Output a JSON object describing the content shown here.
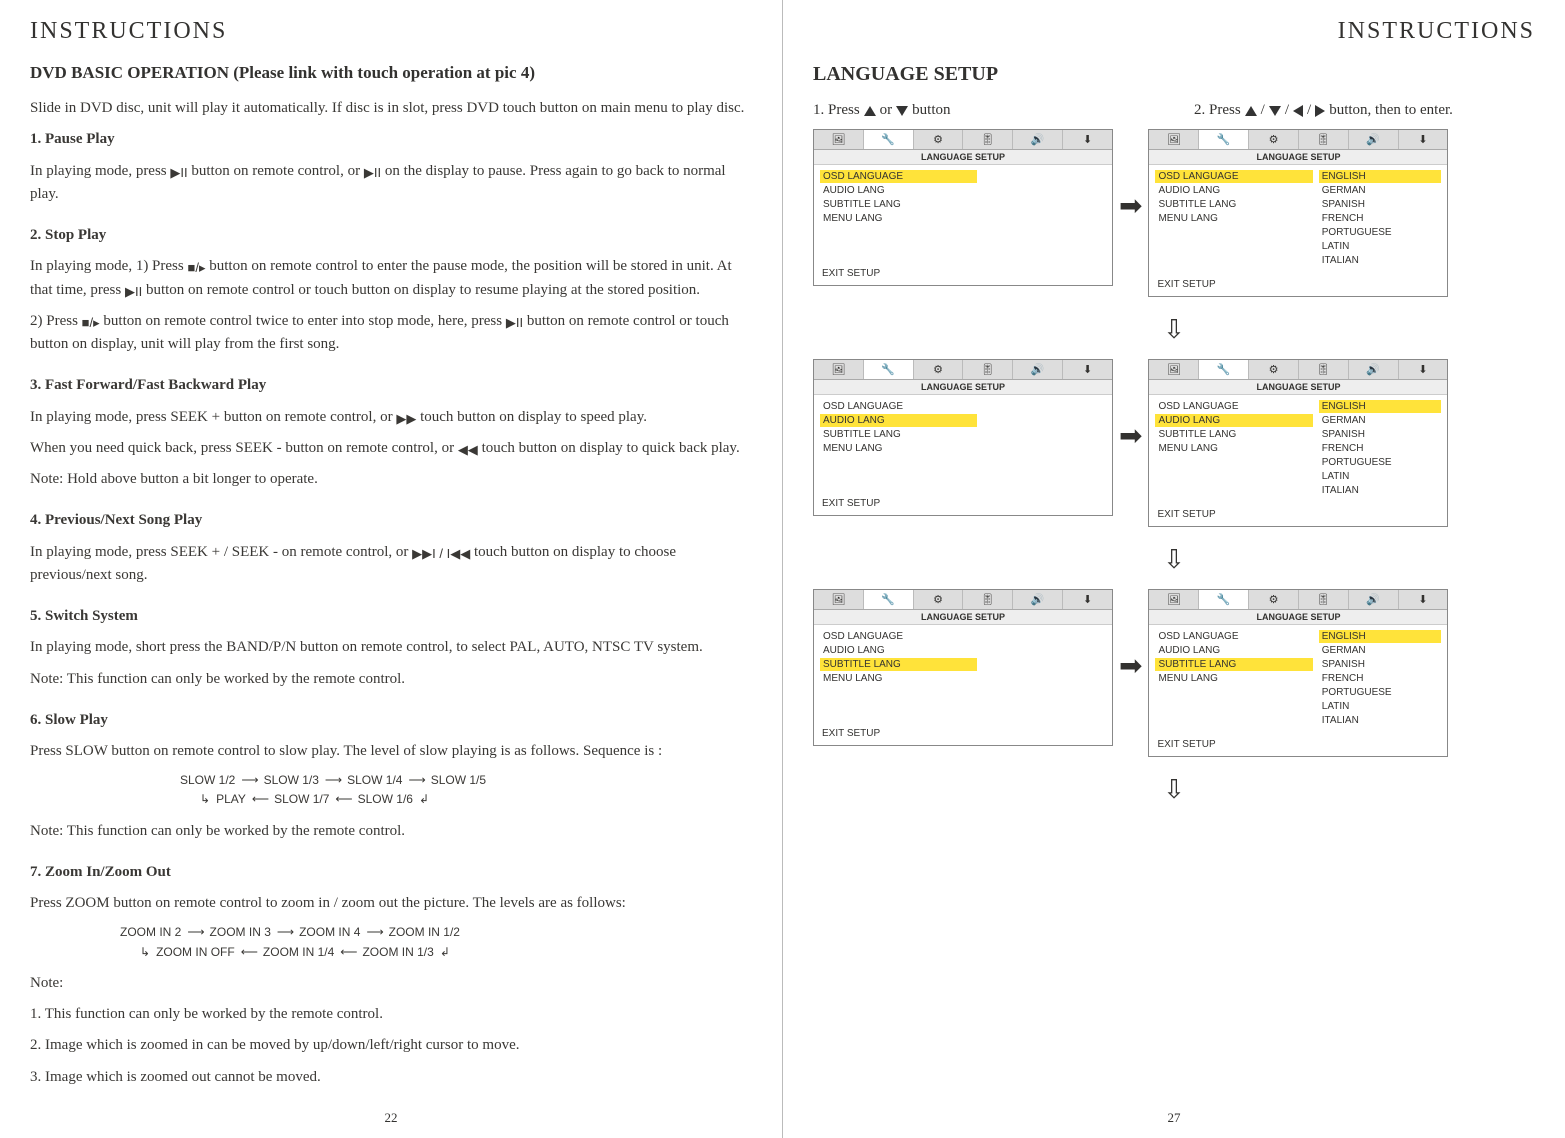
{
  "left": {
    "header": "INSTRUCTIONS",
    "title": "DVD BASIC OPERATION (Please link with touch operation at pic 4)",
    "intro": "Slide in DVD disc, unit will play it automatically. If disc is in slot, press DVD touch button on main menu to play disc.",
    "s1_h": "1. Pause Play",
    "s1_a": "In playing mode, press ",
    "s1_b": " button on remote control, or ",
    "s1_c": " on the display to pause. Press again to go back to normal play.",
    "s2_h": "2. Stop Play",
    "s2_a": "In playing mode, 1) Press ",
    "s2_b": " button on remote control to enter the pause mode, the position will be stored in unit. At that time, press ",
    "s2_c": " button on remote control or touch button on display to resume playing at the stored position.",
    "s2_d": "2) Press ",
    "s2_e": " button on remote control twice to enter into stop mode, here, press ",
    "s2_f": " button on remote control or touch button on display, unit will play from the first song.",
    "s3_h": "3. Fast Forward/Fast Backward Play",
    "s3_a": "In playing mode, press SEEK + button on remote control, or ",
    "s3_b": " touch button on display to speed play.",
    "s3_c": "When you need quick back, press SEEK - button on remote control, or ",
    "s3_d": " touch button on display to quick back play.",
    "s3_note": "Note: Hold above button a bit longer to operate.",
    "s4_h": "4. Previous/Next Song Play",
    "s4_a": "In playing mode, press SEEK + / SEEK - on remote control, or ",
    "s4_b": " touch button on display to choose previous/next song.",
    "s5_h": "5. Switch System",
    "s5_a": "In playing mode, short press the BAND/P/N button on remote control, to select PAL, AUTO, NTSC TV system.",
    "s5_note": "Note: This function can only be worked by the remote control.",
    "s6_h": "6.  Slow Play",
    "s6_a": "Press SLOW button on remote control to slow play. The level of slow playing is as follows. Sequence is :",
    "s6_seq_top": [
      "SLOW 1/2",
      "SLOW 1/3",
      "SLOW 1/4",
      "SLOW 1/5"
    ],
    "s6_seq_bot": [
      "PLAY",
      "SLOW 1/7",
      "SLOW 1/6"
    ],
    "s6_note": "Note: This function can only be worked by the remote control.",
    "s7_h": "7. Zoom In/Zoom Out",
    "s7_a": "Press ZOOM button on remote control to zoom in / zoom out the picture. The levels are as follows:",
    "s7_seq_top": [
      "ZOOM IN 2",
      "ZOOM IN 3",
      "ZOOM IN 4",
      "ZOOM IN 1/2"
    ],
    "s7_seq_bot": [
      "ZOOM IN OFF",
      "ZOOM IN 1/4",
      "ZOOM IN 1/3"
    ],
    "s7_note_h": "Note:",
    "s7_n1": "1.  This function can only be worked by the remote control.",
    "s7_n2": "2.  Image which is zoomed in can be moved by up/down/left/right cursor to move.",
    "s7_n3": "3.  Image which is zoomed out cannot be moved.",
    "pagenum": "22"
  },
  "right": {
    "header": "INSTRUCTIONS",
    "title": "LANGUAGE SETUP",
    "step1": "1. Press ",
    "step1_mid": " or ",
    "step1_end": " button",
    "step2": "2. Press ",
    "step2_end": " button, then to enter.",
    "tab_icons": [
      "🖼",
      "🔧",
      "⚙",
      "🎚",
      "🔊",
      "⬇"
    ],
    "osd_title": "LANGUAGE SETUP",
    "menu_items": [
      "OSD LANGUAGE",
      "AUDIO LANG",
      "SUBTITLE LANG",
      "MENU LANG"
    ],
    "lang_options": [
      "ENGLISH",
      "GERMAN",
      "SPANISH",
      "FRENCH",
      "PORTUGUESE",
      "LATIN",
      "ITALIAN"
    ],
    "exit": "EXIT SETUP",
    "pagenum": "27"
  }
}
